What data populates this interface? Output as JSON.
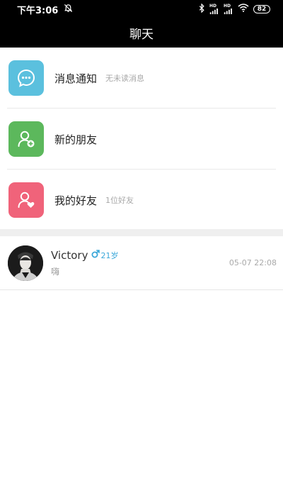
{
  "status_bar": {
    "time": "下午3:06",
    "network_label": "HD",
    "battery": "82"
  },
  "header": {
    "title": "聊天"
  },
  "menu": [
    {
      "label": "消息通知",
      "sub": "无未读消息",
      "color": "#5bc0de",
      "icon": "message-icon"
    },
    {
      "label": "新的朋友",
      "sub": "",
      "color": "#5cb85c",
      "icon": "add-user-icon"
    },
    {
      "label": "我的好友",
      "sub": "1位好友",
      "color": "#f0637a",
      "icon": "favorite-user-icon"
    }
  ],
  "chat": {
    "name": "Victory",
    "age": "21岁",
    "gender": "male",
    "message": "嗨",
    "time": "05-07 22:08"
  },
  "colors": {
    "header_bg": "#000000",
    "gender_blue": "#3aa7d9"
  }
}
